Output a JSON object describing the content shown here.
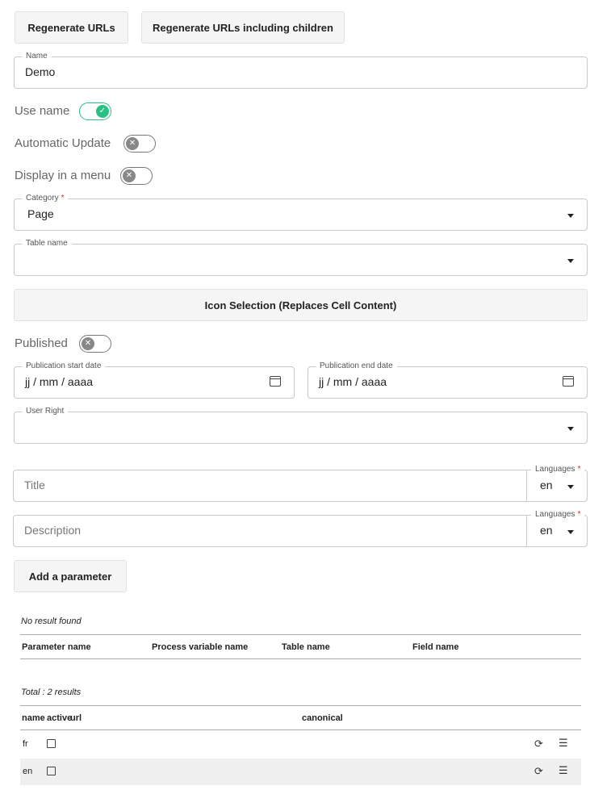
{
  "toolbar": {
    "regenerate_label": "Regenerate URLs",
    "regenerate_children_label": "Regenerate URLs including children"
  },
  "name_field": {
    "label": "Name",
    "value": "Demo"
  },
  "toggles": {
    "use_name": {
      "label": "Use name",
      "checked": true
    },
    "automatic_update": {
      "label": "Automatic Update",
      "checked": false
    },
    "display_menu": {
      "label": "Display in a menu",
      "checked": false
    },
    "published": {
      "label": "Published",
      "checked": false
    }
  },
  "category": {
    "label": "Category",
    "required_mark": "*",
    "value": "Page"
  },
  "table_name": {
    "label": "Table name",
    "value": ""
  },
  "icon_selection_label": "Icon Selection (Replaces Cell Content)",
  "dates": {
    "start": {
      "label": "Publication start date",
      "placeholder": "jj / mm / aaaa"
    },
    "end": {
      "label": "Publication end date",
      "placeholder": "jj / mm / aaaa"
    }
  },
  "user_right": {
    "label": "User Right",
    "value": ""
  },
  "title_field": {
    "placeholder": "Title",
    "lang_label": "Languages",
    "required_mark": "*",
    "lang_value": "en"
  },
  "description_field": {
    "placeholder": "Description",
    "lang_label": "Languages",
    "required_mark": "*",
    "lang_value": "en"
  },
  "add_parameter_label": "Add a parameter",
  "params_table": {
    "empty_text": "No result found",
    "headers": [
      "Parameter name",
      "Process variable name",
      "Table name",
      "Field name"
    ]
  },
  "urls_table": {
    "total_text": "Total : 2 results",
    "headers": [
      "name",
      "active",
      "url",
      "canonical"
    ],
    "rows": [
      {
        "name": "fr",
        "active": false
      },
      {
        "name": "en",
        "active": false
      }
    ]
  },
  "colors": {
    "toggle_on": "#27c283",
    "required": "#d32f2f",
    "row_alt": "#f0f0f0"
  },
  "icons": {
    "row_refresh": "refresh-icon",
    "row_menu": "menu-lines-icon"
  }
}
